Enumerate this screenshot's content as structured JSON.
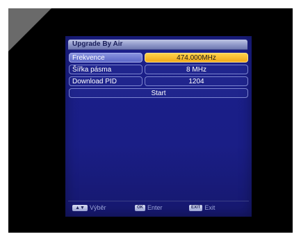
{
  "window": {
    "title": "Upgrade By Air"
  },
  "rows": [
    {
      "label": "Frekvence",
      "value": "474.000MHz"
    },
    {
      "label": "Šířka pásma",
      "value": "8 MHz"
    },
    {
      "label": "Download PID",
      "value": "1204"
    }
  ],
  "start_label": "Start",
  "footer": {
    "hints": [
      {
        "key": "▲▼",
        "label": "Výběr"
      },
      {
        "key": "OK",
        "label": "Enter"
      },
      {
        "key": "EXIT",
        "label": "Exit"
      }
    ]
  },
  "colors": {
    "screen_background": "#1b1f8a",
    "selected_value_accent": "#f5b21f",
    "selected_label_accent": "#6f78cf"
  }
}
